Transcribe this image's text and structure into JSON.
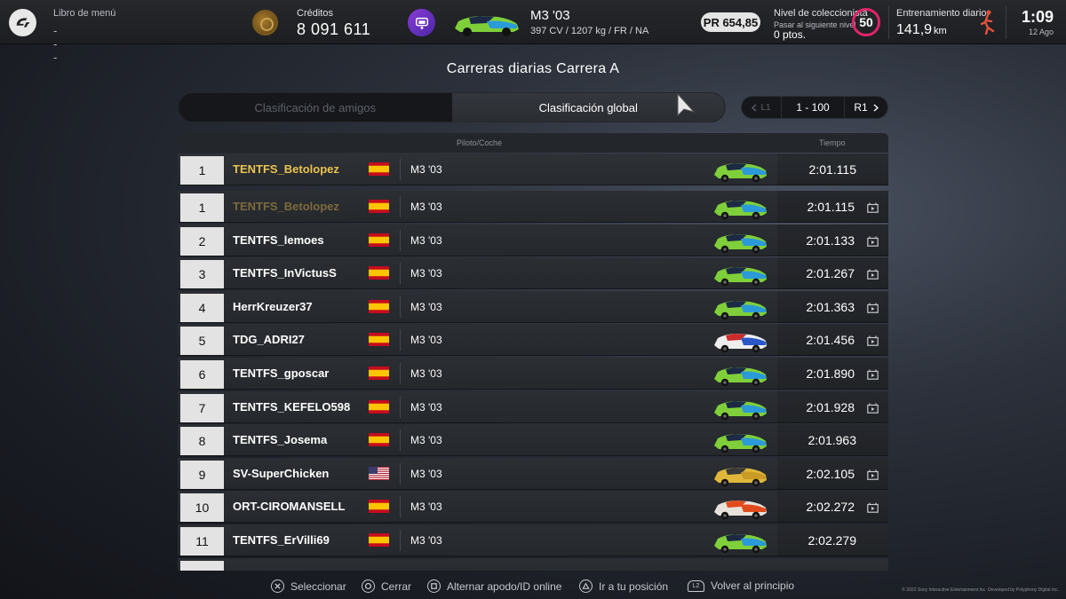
{
  "topbar": {
    "menu_book_label": "Libro de menú",
    "menu_book_value": "---",
    "credits_label": "Créditos",
    "credits_value": "8 091 611",
    "car_title": "M3 '03",
    "car_specs": "397 CV / 1207 kg / FR / NA",
    "pr_value": "PR 654,85",
    "collector_label": "Nivel de coleccionista",
    "collector_next": "Pasar al siguiente nivel",
    "collector_points": "0 ptos.",
    "collector_level": "50",
    "training_label": "Entrenamiento diario",
    "training_value": "141,9",
    "training_unit": "km",
    "time": "1:09",
    "date": "12 Ago",
    "icons": [
      "gt-logo-icon",
      "credits-coin-icon",
      "garage-icon",
      "runner-icon"
    ]
  },
  "page": {
    "title": "Carreras diarias Carrera A",
    "tab_friends": "Clasificación de amigos",
    "tab_global": "Clasificación global",
    "pager_prev": "L1",
    "pager_range": "1 - 100",
    "pager_next": "R1"
  },
  "table": {
    "col_pilot": "Piloto/Coche",
    "col_time": "Tiempo",
    "my_entry": {
      "rank": "1",
      "name": "TENTFS_Betolopez",
      "country": "ES",
      "car": "M3 '03",
      "time": "2:01.115",
      "livery": "green-blue"
    },
    "rows": [
      {
        "rank": "1",
        "name": "TENTFS_Betolopez",
        "country": "ES",
        "car": "M3 '03",
        "time": "2:01.115",
        "replay": true,
        "livery": "green-blue",
        "dim": true
      },
      {
        "rank": "2",
        "name": "TENTFS_lemoes",
        "country": "ES",
        "car": "M3 '03",
        "time": "2:01.133",
        "replay": true,
        "livery": "green-blue"
      },
      {
        "rank": "3",
        "name": "TENTFS_InVictusS",
        "country": "ES",
        "car": "M3 '03",
        "time": "2:01.267",
        "replay": true,
        "livery": "green-blue"
      },
      {
        "rank": "4",
        "name": "HerrKreuzer37",
        "country": "ES",
        "car": "M3 '03",
        "time": "2:01.363",
        "replay": true,
        "livery": "green-blue"
      },
      {
        "rank": "5",
        "name": "TDG_ADRI27",
        "country": "ES",
        "car": "M3 '03",
        "time": "2:01.456",
        "replay": true,
        "livery": "white-m"
      },
      {
        "rank": "6",
        "name": "TENTFS_gposcar",
        "country": "ES",
        "car": "M3 '03",
        "time": "2:01.890",
        "replay": true,
        "livery": "green-blue"
      },
      {
        "rank": "7",
        "name": "TENTFS_KEFELO598",
        "country": "ES",
        "car": "M3 '03",
        "time": "2:01.928",
        "replay": true,
        "livery": "green-blue"
      },
      {
        "rank": "8",
        "name": "TENTFS_Josema",
        "country": "ES",
        "car": "M3 '03",
        "time": "2:01.963",
        "replay": false,
        "livery": "green-blue"
      },
      {
        "rank": "9",
        "name": "SV-SuperChicken",
        "country": "US",
        "car": "M3 '03",
        "time": "2:02.105",
        "replay": true,
        "livery": "yellow"
      },
      {
        "rank": "10",
        "name": "ORT-CIROMANSELL",
        "country": "ES",
        "car": "M3 '03",
        "time": "2:02.272",
        "replay": true,
        "livery": "orange"
      },
      {
        "rank": "11",
        "name": "TENTFS_ErVilli69",
        "country": "ES",
        "car": "M3 '03",
        "time": "2:02.279",
        "replay": false,
        "livery": "green-blue"
      }
    ]
  },
  "bottom": {
    "select": "Seleccionar",
    "close": "Cerrar",
    "toggle": "Alternar apodo/ID online",
    "goto": "Ir a tu posición",
    "back_top": "Volver al principio",
    "l2": "L2",
    "copyright": "© 2022 Sony Interactive Entertainment Inc. Developed by Polyphony Digital Inc."
  },
  "colors": {
    "gold_name": "#e9c34e",
    "level_ring": "#e2246a",
    "rank_box": "#e3e3e3"
  }
}
